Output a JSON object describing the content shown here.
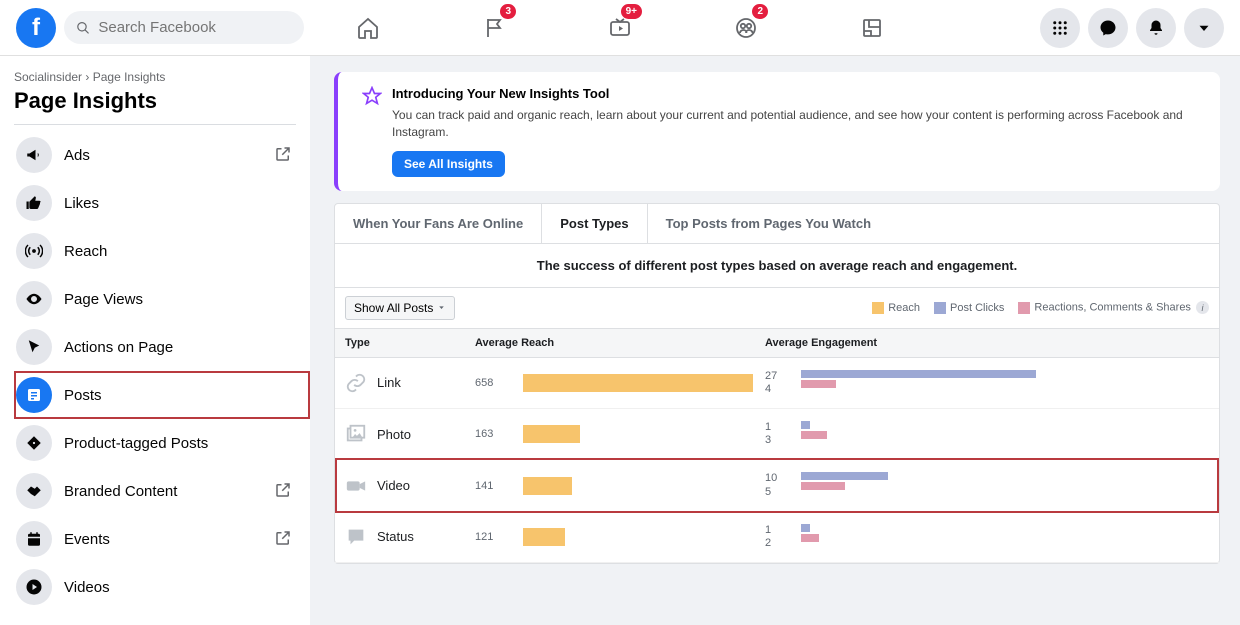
{
  "search": {
    "placeholder": "Search Facebook"
  },
  "nav_badges": {
    "pages": "3",
    "watch": "9+",
    "groups": "2"
  },
  "breadcrumb": {
    "0": "Socialinsider",
    "1": "Page Insights"
  },
  "page_title": "Page Insights",
  "sidebar": {
    "items": {
      "ads": "Ads",
      "likes": "Likes",
      "reach": "Reach",
      "page_views": "Page Views",
      "actions": "Actions on Page",
      "posts": "Posts",
      "product_tagged": "Product-tagged Posts",
      "branded": "Branded Content",
      "events": "Events",
      "videos": "Videos"
    }
  },
  "banner": {
    "title": "Introducing Your New Insights Tool",
    "text": "You can track paid and organic reach, learn about your current and potential audience, and see how your content is performing across Facebook and Instagram.",
    "button": "See All Insights"
  },
  "tabs": {
    "fans_online": "When Your Fans Are Online",
    "post_types": "Post Types",
    "top_posts": "Top Posts from Pages You Watch"
  },
  "subtitle": "The success of different post types based on average reach and engagement.",
  "filter_button": "Show All Posts",
  "legend": {
    "reach": "Reach",
    "clicks": "Post Clicks",
    "reactions": "Reactions, Comments & Shares"
  },
  "columns": {
    "type": "Type",
    "reach": "Average Reach",
    "engagement": "Average Engagement"
  },
  "rows": {
    "link": {
      "label": "Link",
      "reach": "658",
      "clicks": "27",
      "reacts": "4"
    },
    "photo": {
      "label": "Photo",
      "reach": "163",
      "clicks": "1",
      "reacts": "3"
    },
    "video": {
      "label": "Video",
      "reach": "141",
      "clicks": "10",
      "reacts": "5"
    },
    "status": {
      "label": "Status",
      "reach": "121",
      "clicks": "1",
      "reacts": "2"
    }
  },
  "chart_data": {
    "type": "bar",
    "title": "The success of different post types based on average reach and engagement.",
    "categories": [
      "Link",
      "Photo",
      "Video",
      "Status"
    ],
    "series": [
      {
        "name": "Average Reach",
        "values": [
          658,
          163,
          141,
          121
        ]
      },
      {
        "name": "Post Clicks",
        "values": [
          27,
          1,
          10,
          1
        ]
      },
      {
        "name": "Reactions, Comments & Shares",
        "values": [
          4,
          3,
          5,
          2
        ]
      }
    ]
  },
  "colors": {
    "reach": "#f7c46c",
    "clicks": "#9ca8d4",
    "react": "#e19aad",
    "accent": "#1877f2",
    "highlight": "#b93a3f"
  }
}
